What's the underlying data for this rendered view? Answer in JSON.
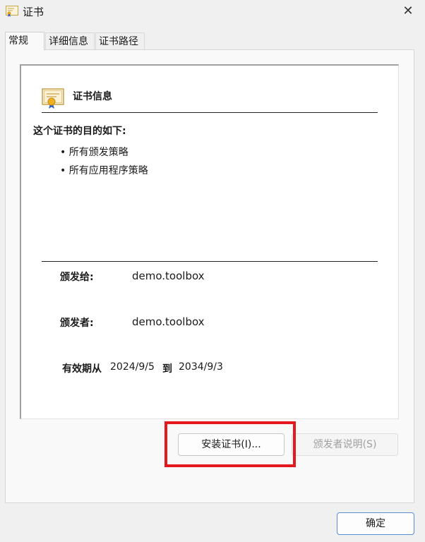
{
  "window": {
    "title": "证书",
    "close_glyph": "✕"
  },
  "tabs": [
    {
      "label": "常规",
      "active": true
    },
    {
      "label": "详细信息",
      "active": false
    },
    {
      "label": "证书路径",
      "active": false
    }
  ],
  "general": {
    "info_title": "证书信息",
    "purpose_heading": "这个证书的目的如下:",
    "purposes": [
      "• 所有颁发策略",
      "• 所有应用程序策略"
    ],
    "issued_to_label": "颁发给:",
    "issued_to_value": "demo.toolbox",
    "issued_by_label": "颁发者:",
    "issued_by_value": "demo.toolbox",
    "valid_label": "有效期从",
    "valid_from": "2024/9/5",
    "valid_to_label": "到",
    "valid_to": "2034/9/3"
  },
  "buttons": {
    "install": "安装证书(I)...",
    "issuer_statement": "颁发者说明(S)",
    "ok": "确定"
  },
  "icons": {
    "title": "certificate-icon",
    "info": "certificate-icon",
    "close": "close-icon"
  },
  "colors": {
    "highlight": "#e3191f",
    "ok_border": "#5a8ed0"
  }
}
